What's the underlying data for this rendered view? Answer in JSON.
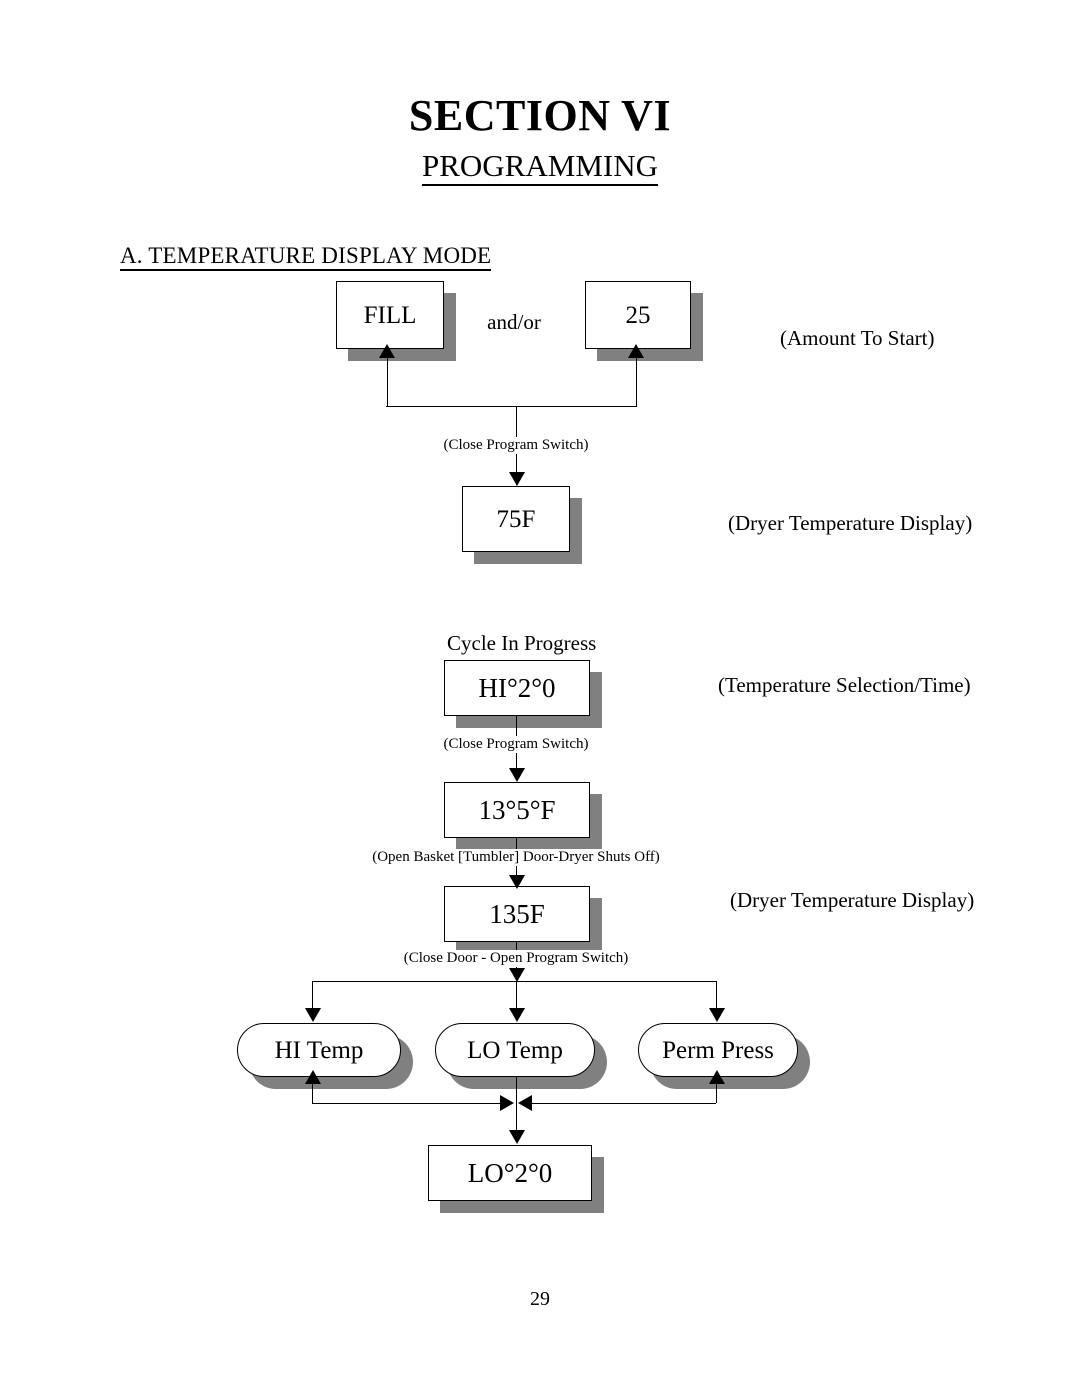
{
  "document": {
    "title": "SECTION VI",
    "subtitle": "PROGRAMMING",
    "section_heading": "A.  TEMPERATURE DISPLAY MODE",
    "page_number": "29"
  },
  "flow": {
    "nodes": {
      "fill": "FILL",
      "amount": "25",
      "dryer_temp_75": "75F",
      "temp_selection": "HI°2°0",
      "temp_135_deg": "13°5°F",
      "dryer_temp_135": "135F",
      "hi_temp": "HI Temp",
      "lo_temp": "LO Temp",
      "perm_press": "Perm Press",
      "lo_20": "LO°2°0"
    },
    "connectors": {
      "and_or": "and/or",
      "close_program_switch_1": "(Close Program Switch)",
      "close_program_switch_2": "(Close Program Switch)",
      "open_basket_door": "(Open Basket [Tumbler] Door-Dryer Shuts Off)",
      "close_door_open_program_switch": "(Close Door - Open Program Switch)",
      "cycle_in_progress": "Cycle In Progress"
    },
    "annotations": {
      "amount_to_start": "(Amount To Start)",
      "dryer_temperature_display_1": "(Dryer Temperature Display)",
      "temperature_selection_time": "(Temperature Selection/Time)",
      "dryer_temperature_display_2": "(Dryer Temperature Display)"
    }
  },
  "colors": {
    "ink": "#000000",
    "shadow": "#808080",
    "paper": "#ffffff"
  }
}
